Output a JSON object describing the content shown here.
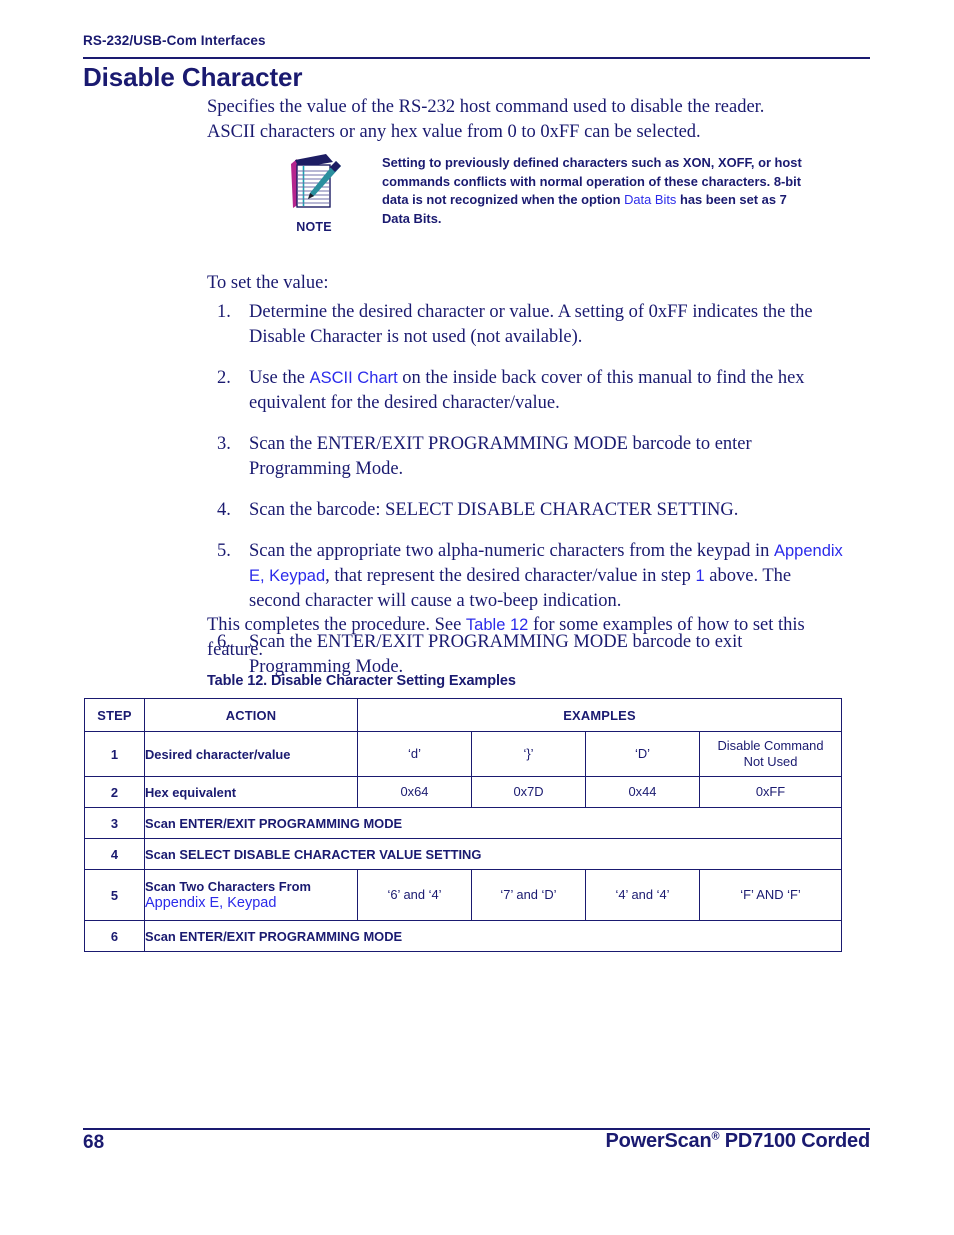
{
  "colors": {
    "ink": "#1a1a70",
    "link": "#2b2bea",
    "rule": "#1a1a70"
  },
  "running_header": "RS-232/USB-Com Interfaces",
  "heading": "Disable Character",
  "intro": {
    "line1": "Specifies the value of the RS-232 host command used to disable the reader.",
    "line2": "ASCII characters or any hex value from 0 to 0xFF can be selected."
  },
  "note": {
    "label": "NOTE",
    "icon": "notepad-pencil-icon",
    "text_part1": "Setting to previously defined characters such as XON, XOFF, or host commands conflicts with normal operation of these characters. 8-bit data is not recognized when the option ",
    "link": "Data Bits",
    "text_part2": " has been set as 7 Data Bits."
  },
  "to_set_value": "To set the value:",
  "steps": [
    {
      "num": "1.",
      "text": "Determine the desired character or value. A setting of 0xFF indicates the the Disable Character is not used (not available)."
    },
    {
      "num": "2.",
      "pre": "Use the ",
      "link": "ASCII Chart",
      "post": " on the inside back cover of this manual to find the hex equivalent for the desired character/value."
    },
    {
      "num": "3.",
      "text": "Scan the ENTER/EXIT PROGRAMMING MODE barcode to enter Programming Mode."
    },
    {
      "num": "4.",
      "text": "Scan the barcode: SELECT DISABLE CHARACTER SETTING."
    },
    {
      "num": "5.",
      "pre": "Scan the appropriate two alpha-numeric characters from the keypad in ",
      "link": "Appendix E, Keypad",
      "mid": ", that represent the desired character/value in step ",
      "link2": "1",
      "post": " above. The second character will cause a two-beep indication."
    },
    {
      "num": "6.",
      "text": "Scan the ENTER/EXIT PROGRAMMING MODE barcode to exit Programming Mode."
    }
  ],
  "closing": {
    "pre": "This completes the procedure. See ",
    "link": "Table 12",
    "post": " for some examples of how to set this feature."
  },
  "table": {
    "caption": "Table 12. Disable Character Setting Examples",
    "headers": [
      "STEP",
      "ACTION",
      "EXAMPLES"
    ],
    "rows": [
      {
        "step": "1",
        "action": "Desired character/value",
        "action_link": "",
        "examples": [
          "‘d’",
          "‘}’",
          "‘D’",
          "Disable Command\nNot Used"
        ],
        "full_span": false
      },
      {
        "step": "2",
        "action": "Hex equivalent",
        "action_link": "",
        "examples": [
          "0x64",
          "0x7D",
          "0x44",
          "0xFF"
        ],
        "full_span": false
      },
      {
        "step": "3",
        "action": "Scan ENTER/EXIT PROGRAMMING MODE",
        "action_link": "",
        "examples": [],
        "full_span": true
      },
      {
        "step": "4",
        "action": "Scan SELECT DISABLE CHARACTER VALUE SETTING",
        "action_link": "",
        "examples": [],
        "full_span": true
      },
      {
        "step": "5",
        "action": "Scan Two Characters From",
        "action_link": "Appendix E, Keypad",
        "examples": [
          "‘6’ and ‘4’",
          "‘7’ and ‘D’",
          "‘4’ and ‘4’",
          "‘F’ AND ‘F’"
        ],
        "full_span": false
      },
      {
        "step": "6",
        "action": "Scan ENTER/EXIT PROGRAMMING MODE",
        "action_link": "",
        "examples": [],
        "full_span": true
      }
    ]
  },
  "footer": {
    "page_number": "68",
    "product_pre": "PowerScan",
    "product_sup": "®",
    "product_post": " PD7100 Corded"
  }
}
